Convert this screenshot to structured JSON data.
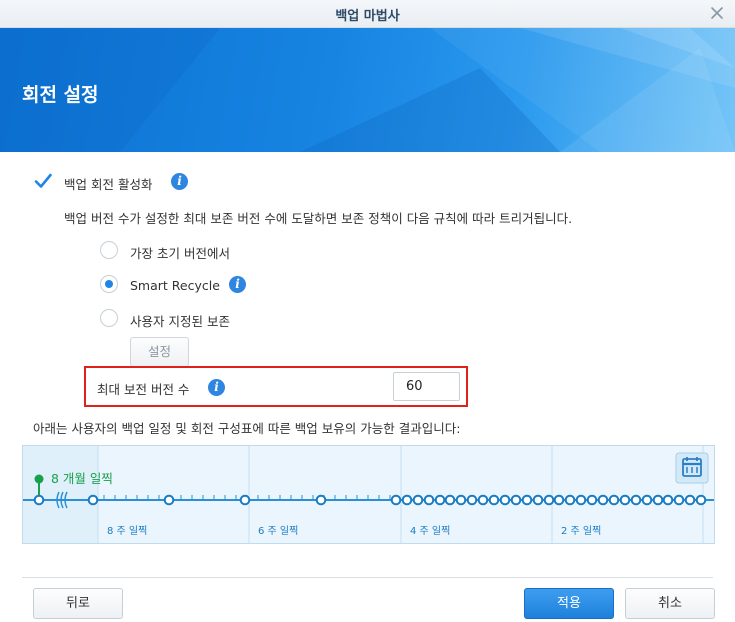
{
  "window": {
    "title": "백업 마법사"
  },
  "banner": {
    "title": "회전 설정"
  },
  "rotation": {
    "enable_label": "백업 회전 활성화",
    "enabled": true,
    "description": "백업 버전 수가 설정한 최대 보존 버전 수에 도달하면 보존 정책이 다음 규칙에 따라 트리거됩니다.",
    "options": [
      {
        "label": "가장 초기 버전에서",
        "selected": false
      },
      {
        "label": "Smart Recycle",
        "selected": true
      },
      {
        "label": "사용자 지정된 보존",
        "selected": false
      }
    ],
    "settings_button": "설정",
    "max_versions_label": "최대 보전 버전 수",
    "max_versions_value": "60"
  },
  "timeline": {
    "caption": "아래는 사용자의 백업 일정 및 회전 구성표에 따른 백업 보유의 가능한 결과입니다:",
    "start_label": "8 개월 일찍",
    "week_labels": [
      "8 주 일찍",
      "6 주 일찍",
      "4 주 일찍",
      "2 주 일찍"
    ],
    "accent_color": "#1a8fd6",
    "marker_color": "#1aa04a",
    "calendar_icon": "calendar-icon"
  },
  "footer": {
    "back": "뒤로",
    "apply": "적용",
    "cancel": "취소"
  }
}
